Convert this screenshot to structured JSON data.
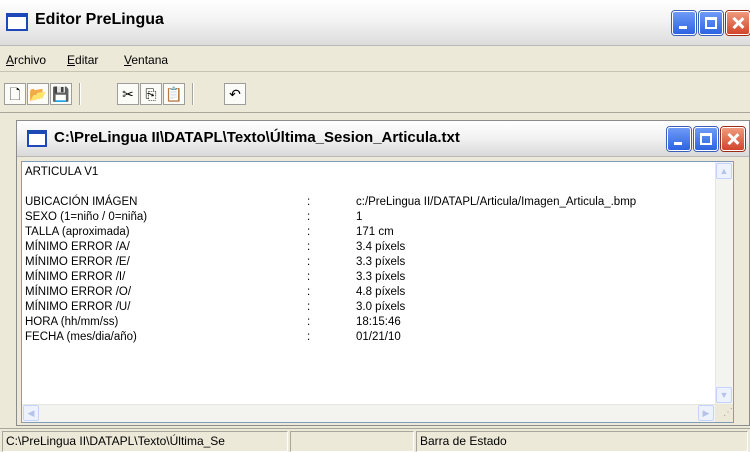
{
  "app": {
    "title": "Editor PreLingua",
    "icon": "window-icon"
  },
  "menu": {
    "items": [
      {
        "label": "Archivo"
      },
      {
        "label": "Editar"
      },
      {
        "label": "Ventana"
      }
    ]
  },
  "toolbar": {
    "buttons": [
      {
        "icon": "new-file-icon",
        "glyph": "🗋"
      },
      {
        "icon": "open-folder-icon",
        "glyph": "📂"
      },
      {
        "icon": "save-icon",
        "glyph": "💾"
      },
      {
        "icon": "cut-icon",
        "glyph": "✂"
      },
      {
        "icon": "copy-icon",
        "glyph": "⎘"
      },
      {
        "icon": "paste-icon",
        "glyph": "📋"
      },
      {
        "icon": "undo-icon",
        "glyph": "↶"
      }
    ]
  },
  "document": {
    "title": "C:\\PreLingua II\\DATAPL\\Texto\\Última_Sesion_Articula.txt",
    "heading": "ARTICULA V1",
    "rows": [
      {
        "key": "UBICACIÓN IMÁGEN",
        "sep": ":",
        "value": "c:/PreLingua II/DATAPL/Articula/Imagen_Articula_.bmp"
      },
      {
        "key": "SEXO (1=niño / 0=niña)",
        "sep": ":",
        "value": "1"
      },
      {
        "key": "TALLA (aproximada)",
        "sep": ":",
        "value": "171 cm"
      },
      {
        "key": "MÍNIMO ERROR /A/",
        "sep": ":",
        "value": "3.4 píxels"
      },
      {
        "key": "MÍNIMO ERROR /E/",
        "sep": ":",
        "value": "3.3 píxels"
      },
      {
        "key": "MÍNIMO ERROR /I/",
        "sep": ":",
        "value": "3.3 píxels"
      },
      {
        "key": "MÍNIMO ERROR /O/",
        "sep": ":",
        "value": "4.8 píxels"
      },
      {
        "key": "MÍNIMO ERROR /U/",
        "sep": ":",
        "value": "3.0 píxels"
      },
      {
        "key": "HORA (hh/mm/ss)",
        "sep": ":",
        "value": "18:15:46"
      },
      {
        "key": "FECHA (mes/dia/año)",
        "sep": ":",
        "value": "01/21/10"
      }
    ]
  },
  "statusbar": {
    "path": "C:\\PreLingua II\\DATAPL\\Texto\\Última_Se",
    "middle": "",
    "status": "Barra de Estado"
  },
  "colors": {
    "titlebar_icon": "#1c48b8",
    "caption_button": "#2c63e0",
    "close_button": "#d1452a",
    "window_face": "#ece9d8"
  }
}
